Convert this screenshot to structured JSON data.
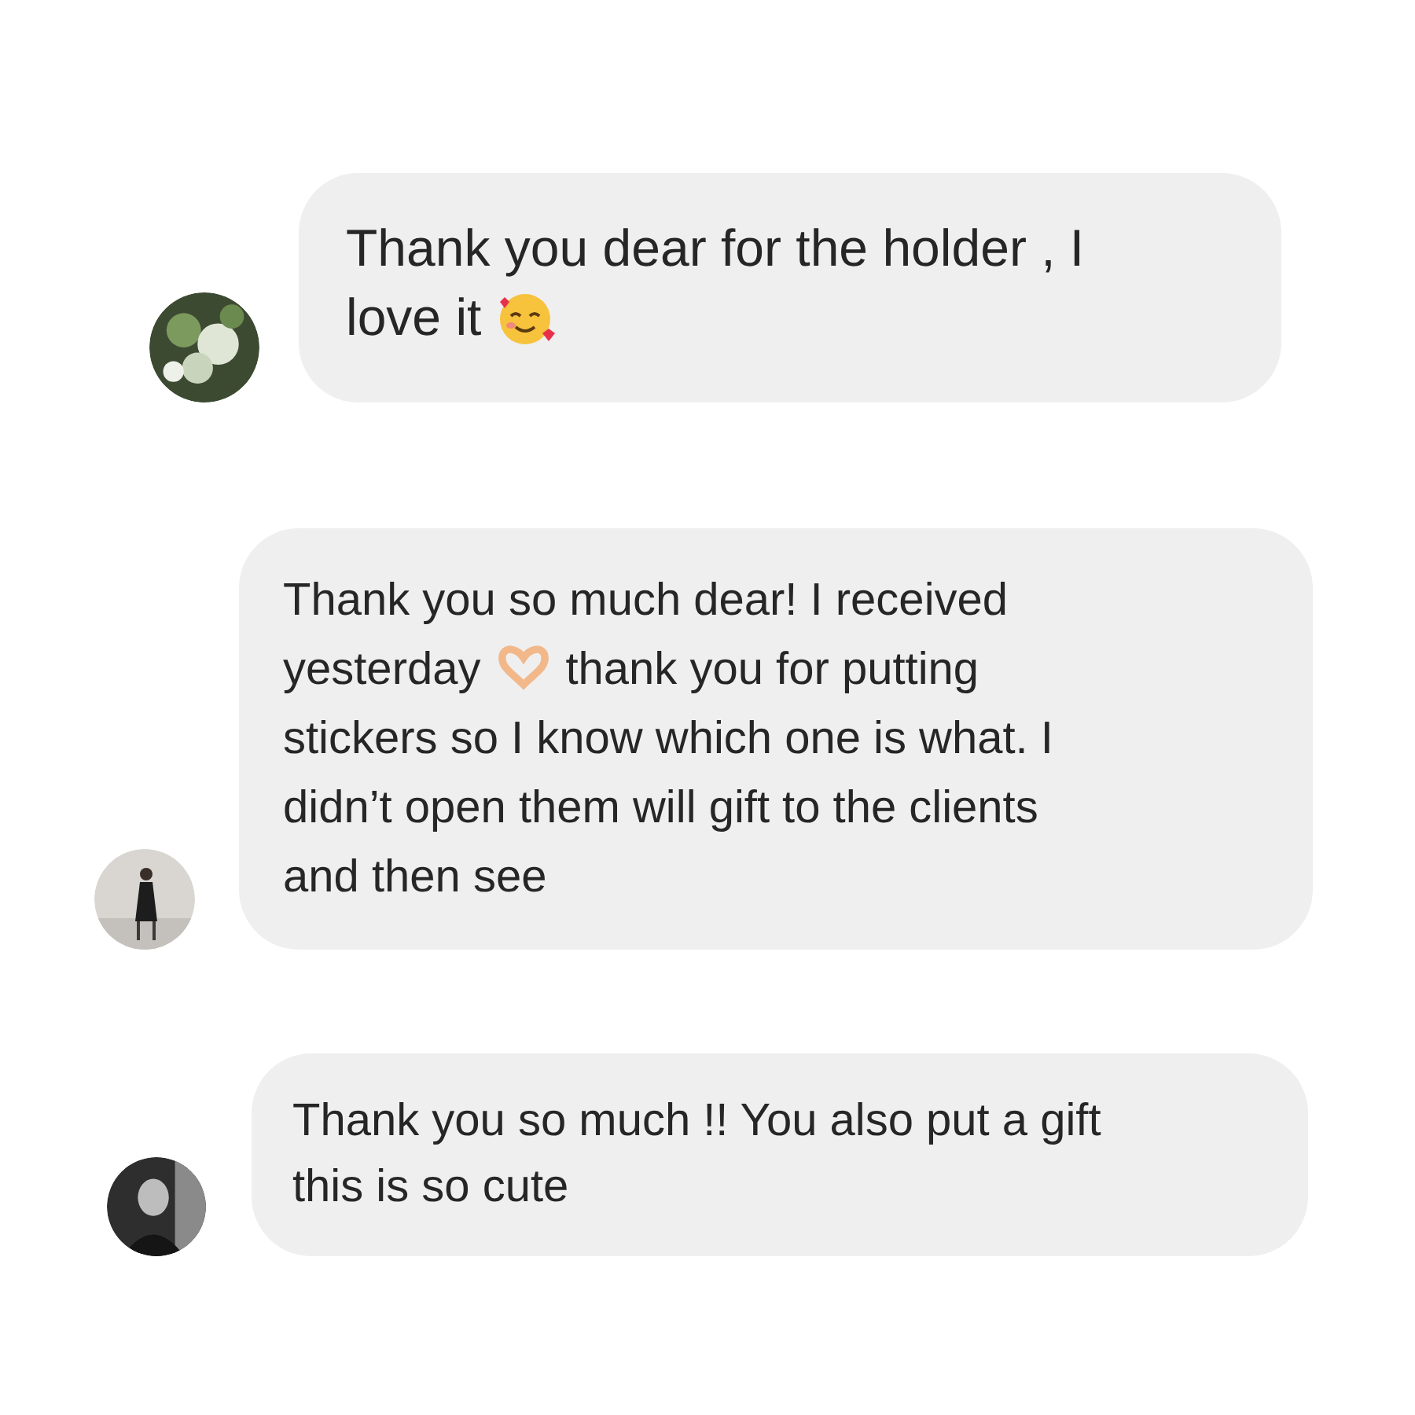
{
  "messages": [
    {
      "avatar": {
        "kind": "picture"
      },
      "lines": [
        [
          {
            "kind": "text",
            "text": "Thank you dear for the holder , I"
          }
        ],
        [
          {
            "kind": "text",
            "text": "love it"
          },
          {
            "kind": "hearts"
          }
        ]
      ]
    },
    {
      "avatar": {
        "kind": "picture"
      },
      "lines": [
        [
          {
            "kind": "text",
            "text": "Thank you so much dear! I received"
          }
        ],
        [
          {
            "kind": "text",
            "text": "yesterday"
          },
          {
            "kind": "hands"
          },
          {
            "kind": "text",
            "text": "thank you for putting"
          }
        ],
        [
          {
            "kind": "text",
            "text": "stickers so I know which one is what. I"
          }
        ],
        [
          {
            "kind": "text",
            "text": "didn’t open them will gift to the clients"
          }
        ],
        [
          {
            "kind": "text",
            "text": "and then see"
          }
        ]
      ]
    },
    {
      "avatar": {
        "kind": "picture"
      },
      "lines": [
        [
          {
            "kind": "text",
            "text": "Thank you so much !! You also put a gift"
          }
        ],
        [
          {
            "kind": "text",
            "text": "this is so cute"
          }
        ]
      ]
    }
  ]
}
